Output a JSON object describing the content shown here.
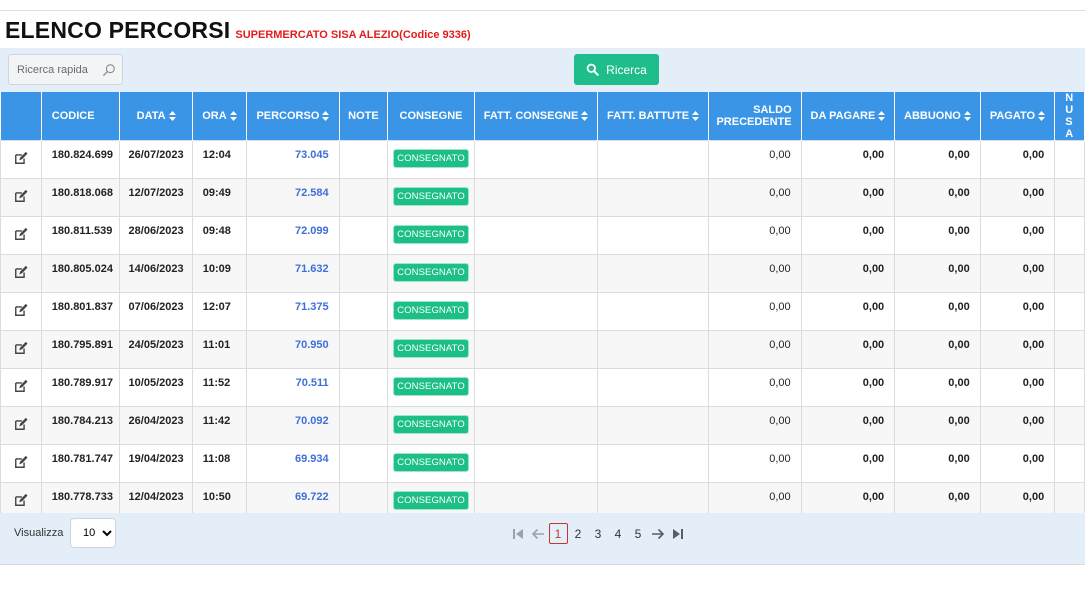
{
  "header": {
    "title": "ELENCO PERCORSI",
    "subtitle": "SUPERMERCATO SISA ALEZIO(Codice 9336)"
  },
  "toolbar": {
    "search_placeholder": "Ricerca rapida",
    "search_icon": "magnifier-icon",
    "search_button_label": "Ricerca"
  },
  "table": {
    "columns": [
      "",
      "CODICE",
      "DATA",
      "ORA",
      "PERCORSO",
      "NOTE",
      "CONSEGNE",
      "FATT. CONSEGNE",
      "FATT. BATTUTE",
      "SALDO PRECEDENTE",
      "DA PAGARE",
      "ABBUONO",
      "PAGATO",
      "NU SA"
    ],
    "rows": [
      {
        "codice": "180.824.699",
        "data": "26/07/2023",
        "ora": "12:04",
        "percorso": "73.045",
        "note": "",
        "consegne": "CONSEGNATO",
        "fatt_consegne": "",
        "fatt_battute": "",
        "saldo": "0,00",
        "da_pagare": "0,00",
        "abbuono": "0,00",
        "pagato": "0,00"
      },
      {
        "codice": "180.818.068",
        "data": "12/07/2023",
        "ora": "09:49",
        "percorso": "72.584",
        "note": "",
        "consegne": "CONSEGNATO",
        "fatt_consegne": "",
        "fatt_battute": "",
        "saldo": "0,00",
        "da_pagare": "0,00",
        "abbuono": "0,00",
        "pagato": "0,00"
      },
      {
        "codice": "180.811.539",
        "data": "28/06/2023",
        "ora": "09:48",
        "percorso": "72.099",
        "note": "",
        "consegne": "CONSEGNATO",
        "fatt_consegne": "",
        "fatt_battute": "",
        "saldo": "0,00",
        "da_pagare": "0,00",
        "abbuono": "0,00",
        "pagato": "0,00"
      },
      {
        "codice": "180.805.024",
        "data": "14/06/2023",
        "ora": "10:09",
        "percorso": "71.632",
        "note": "",
        "consegne": "CONSEGNATO",
        "fatt_consegne": "",
        "fatt_battute": "",
        "saldo": "0,00",
        "da_pagare": "0,00",
        "abbuono": "0,00",
        "pagato": "0,00"
      },
      {
        "codice": "180.801.837",
        "data": "07/06/2023",
        "ora": "12:07",
        "percorso": "71.375",
        "note": "",
        "consegne": "CONSEGNATO",
        "fatt_consegne": "",
        "fatt_battute": "",
        "saldo": "0,00",
        "da_pagare": "0,00",
        "abbuono": "0,00",
        "pagato": "0,00"
      },
      {
        "codice": "180.795.891",
        "data": "24/05/2023",
        "ora": "11:01",
        "percorso": "70.950",
        "note": "",
        "consegne": "CONSEGNATO",
        "fatt_consegne": "",
        "fatt_battute": "",
        "saldo": "0,00",
        "da_pagare": "0,00",
        "abbuono": "0,00",
        "pagato": "0,00"
      },
      {
        "codice": "180.789.917",
        "data": "10/05/2023",
        "ora": "11:52",
        "percorso": "70.511",
        "note": "",
        "consegne": "CONSEGNATO",
        "fatt_consegne": "",
        "fatt_battute": "",
        "saldo": "0,00",
        "da_pagare": "0,00",
        "abbuono": "0,00",
        "pagato": "0,00"
      },
      {
        "codice": "180.784.213",
        "data": "26/04/2023",
        "ora": "11:42",
        "percorso": "70.092",
        "note": "",
        "consegne": "CONSEGNATO",
        "fatt_consegne": "",
        "fatt_battute": "",
        "saldo": "0,00",
        "da_pagare": "0,00",
        "abbuono": "0,00",
        "pagato": "0,00"
      },
      {
        "codice": "180.781.747",
        "data": "19/04/2023",
        "ora": "11:08",
        "percorso": "69.934",
        "note": "",
        "consegne": "CONSEGNATO",
        "fatt_consegne": "",
        "fatt_battute": "",
        "saldo": "0,00",
        "da_pagare": "0,00",
        "abbuono": "0,00",
        "pagato": "0,00"
      },
      {
        "codice": "180.778.733",
        "data": "12/04/2023",
        "ora": "10:50",
        "percorso": "69.722",
        "note": "",
        "consegne": "CONSEGNATO",
        "fatt_consegne": "",
        "fatt_battute": "",
        "saldo": "0,00",
        "da_pagare": "0,00",
        "abbuono": "0,00",
        "pagato": "0,00"
      }
    ]
  },
  "footer": {
    "page_size_label": "Visualizza",
    "page_size_value": "10",
    "pages": [
      "1",
      "2",
      "3",
      "4",
      "5"
    ],
    "current_page": "1"
  },
  "colors": {
    "header_bg": "#3a95e6",
    "toolbar_bg": "#e3eef9",
    "accent_green": "#1fbc8c",
    "title_red": "#e31b1b",
    "link_blue": "#3f6fd9"
  }
}
